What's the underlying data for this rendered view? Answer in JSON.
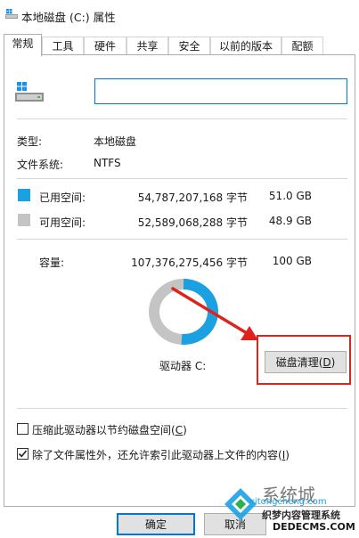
{
  "window": {
    "title": "本地磁盘 (C:) 属性"
  },
  "tabs": [
    {
      "label": "常规",
      "active": true
    },
    {
      "label": "工具"
    },
    {
      "label": "硬件"
    },
    {
      "label": "共享"
    },
    {
      "label": "安全"
    },
    {
      "label": "以前的版本"
    },
    {
      "label": "配额"
    }
  ],
  "general": {
    "drive_name_value": "",
    "type_label": "类型:",
    "type_value": "本地磁盘",
    "fs_label": "文件系统:",
    "fs_value": "NTFS",
    "used_label": "已用空间:",
    "used_bytes": "54,787,207,168 字节",
    "used_gb": "51.0 GB",
    "free_label": "可用空间:",
    "free_bytes": "52,589,068,288 字节",
    "free_gb": "48.9 GB",
    "capacity_label": "容量:",
    "capacity_bytes": "107,376,275,456 字节",
    "capacity_gb": "100 GB",
    "drive_label": "驱动器 C:",
    "cleanup_button_pre": "磁盘清理(",
    "cleanup_button_key": "D",
    "cleanup_button_post": ")",
    "compress_pre": "压缩此驱动器以节约磁盘空间(",
    "compress_key": "C",
    "compress_post": ")",
    "compress_checked": false,
    "index_pre": "除了文件属性外，还允许索引此驱动器上文件的内容(",
    "index_key": "I",
    "index_post": ")",
    "index_checked": true
  },
  "usage": {
    "used_fraction": 0.51,
    "free_fraction": 0.49
  },
  "colors": {
    "used": "#1ba1e2",
    "free": "#c4c4c4",
    "accent": "#0078d7",
    "annotation": "#e0221b"
  },
  "buttons": {
    "ok": "确定",
    "cancel": "取消"
  },
  "watermark": {
    "brand": "系统城",
    "site": "xitongcheng.com",
    "caption": "织梦内容管理系统",
    "domain": "DEDECMS.COM"
  }
}
